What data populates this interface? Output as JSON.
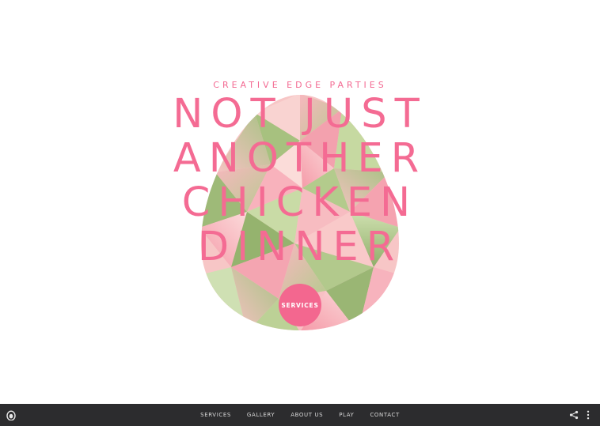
{
  "hero": {
    "eyebrow": "CREATIVE EDGE PARTIES",
    "headline_lines": [
      "NOT JUST",
      "ANOTHER",
      "CHICKEN",
      "DINNER"
    ],
    "cta_label": "SERVICES"
  },
  "nav": {
    "items": [
      "SERVICES",
      "GALLERY",
      "ABOUT US",
      "PLAY",
      "CONTACT"
    ]
  },
  "icons": {
    "logo": "egg-logo-icon",
    "share": "share-icon",
    "more": "more-vertical-icon"
  },
  "colors": {
    "accent_pink": "#f46b93",
    "egg_green": "#a9c489",
    "egg_pink": "#f7a9b5",
    "bar_bg": "#2c2c2e",
    "nav_text": "#d8d8d8"
  }
}
